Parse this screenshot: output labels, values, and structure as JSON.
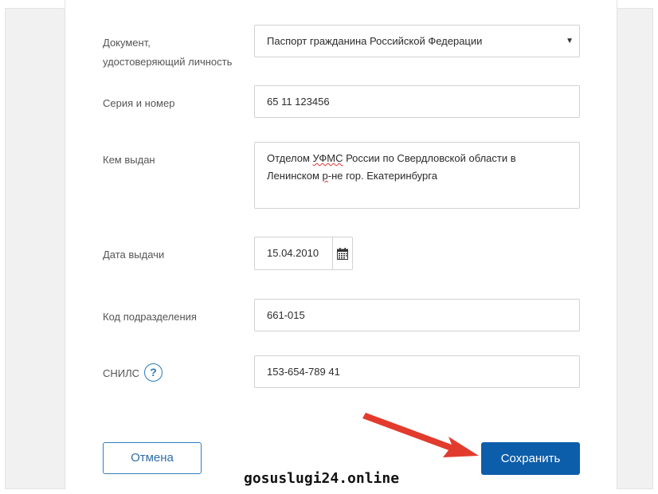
{
  "form": {
    "document": {
      "label_line1": "Документ,",
      "label_line2": "удостоверяющий личность",
      "value": "Паспорт гражданина Российской Федерации"
    },
    "series_number": {
      "label": "Серия и номер",
      "value": "65 11 123456"
    },
    "issued_by": {
      "label": "Кем выдан",
      "line1_prefix": "Отделом ",
      "line1_flagged": "УФМС",
      "line1_suffix": " России по Свердловской области в",
      "line2_prefix": "Ленинском ",
      "line2_flagged": "р",
      "line2_suffix": "-не гор. Екатеринбурга"
    },
    "issue_date": {
      "label": "Дата выдачи",
      "value": "15.04.2010"
    },
    "division_code": {
      "label": "Код подразделения",
      "value": "661-015"
    },
    "snils": {
      "label": "СНИЛС",
      "help": "?",
      "value": "153-654-789 41"
    }
  },
  "actions": {
    "cancel": "Отмена",
    "save": "Сохранить"
  },
  "watermark": "gosuslugi24.online",
  "icons": {
    "select": "caret-down-icon",
    "date": "calendar-icon",
    "help": "help-icon",
    "annotation": "red-arrow-icon"
  },
  "colors": {
    "primary": "#0d5eaa",
    "link": "#2f7fc0",
    "arrow": "#e23b2e"
  }
}
